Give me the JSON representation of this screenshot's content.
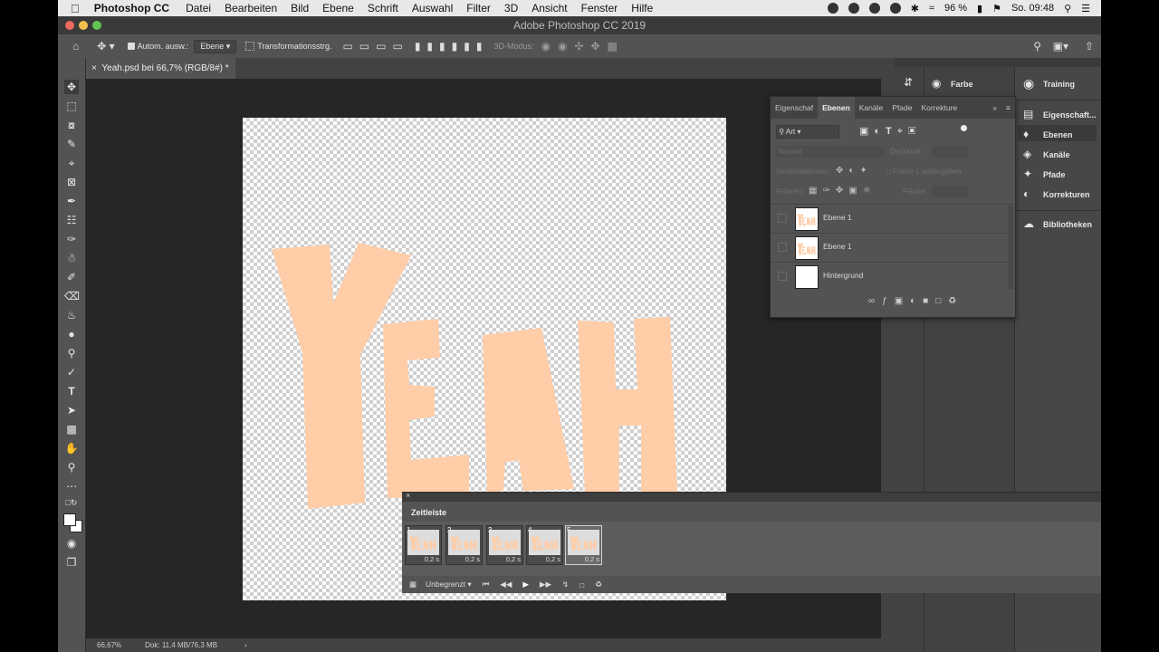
{
  "menubar": {
    "app": "Photoshop CC",
    "items": [
      "Datei",
      "Bearbeiten",
      "Bild",
      "Ebene",
      "Schrift",
      "Auswahl",
      "Filter",
      "3D",
      "Ansicht",
      "Fenster",
      "Hilfe"
    ],
    "battery": "96 %",
    "clock": "So. 09:48"
  },
  "window": {
    "title": "Adobe Photoshop CC 2019"
  },
  "options": {
    "auto_select": "Autom. ausw.:",
    "auto_select_target": "Ebene",
    "transform": "Transformationsstrg.",
    "mode_3d": "3D-Modus:"
  },
  "document": {
    "tab": "Yeah.psd bei 66,7% (RGB/8#) *"
  },
  "canvas": {
    "text": "YEAH",
    "color": "#ffcda8"
  },
  "status": {
    "zoom": "66,67%",
    "doc": "Dok: 11,4 MB/76,3 MB"
  },
  "dock": {
    "farbe": "Farbe",
    "items": [
      "Training",
      "Eigenschaft...",
      "Ebenen",
      "Kanäle",
      "Pfade",
      "Korrekturen",
      "Bibliotheken"
    ]
  },
  "layers_panel": {
    "tabs": [
      "Eigenschaf",
      "Ebenen",
      "Kanäle",
      "Pfade",
      "Korrekture"
    ],
    "filter": "Art",
    "blend": "Normal",
    "opacity_label": "Deckkraft:",
    "lock_label": "Fixieren:",
    "fill_label": "Fläche:",
    "layers": [
      "Ebene 1",
      "Ebene 1",
      "Hintergrund"
    ]
  },
  "timeline": {
    "title": "Zeitleiste",
    "frames": [
      {
        "n": "1",
        "d": "0,2 s"
      },
      {
        "n": "2",
        "d": "0,2 s"
      },
      {
        "n": "3",
        "d": "0,2 s"
      },
      {
        "n": "4",
        "d": "0,2 s"
      },
      {
        "n": "5",
        "d": "0,2 s"
      }
    ],
    "loop": "Unbegrenzt"
  }
}
